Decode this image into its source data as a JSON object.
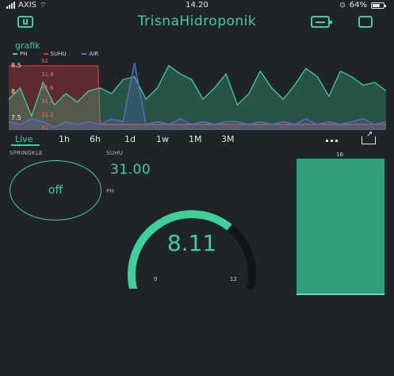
{
  "status_bar": {
    "carrier": "AXIS",
    "time": "14.20",
    "battery": "64%"
  },
  "header": {
    "title": "TrisnaHidroponik"
  },
  "chart": {
    "title": "grafik",
    "legend": [
      "PH",
      "SUHU",
      "AIR"
    ],
    "y_ticks_ph": [
      "8.5",
      "8",
      "7.5"
    ],
    "y_ticks_suhu": [
      "32",
      "31.8",
      "31.6",
      "31.4",
      "31.2",
      "31"
    ],
    "ranges": [
      "Live",
      "1h",
      "6h",
      "1d",
      "1w",
      "1M",
      "3M"
    ],
    "active_range": "Live"
  },
  "chart_data": {
    "type": "line",
    "x": [
      0,
      1,
      2,
      3,
      4,
      5,
      6,
      7,
      8,
      9,
      10,
      11,
      12,
      13,
      14,
      15,
      16,
      17,
      18,
      19,
      20,
      21,
      22,
      23,
      24,
      25,
      26,
      27,
      28,
      29,
      30,
      31,
      32,
      33
    ],
    "series": [
      {
        "name": "PH",
        "color": "#3fcf9c",
        "fill": true,
        "values": [
          7.9,
          8.1,
          7.6,
          8.2,
          7.8,
          8.0,
          7.85,
          8.05,
          8.1,
          8.0,
          8.25,
          8.3,
          7.9,
          8.1,
          8.5,
          8.35,
          8.25,
          7.9,
          8.1,
          8.35,
          7.8,
          8.0,
          8.4,
          8.1,
          7.9,
          8.15,
          8.45,
          8.3,
          7.95,
          8.4,
          8.3,
          8.15,
          8.2,
          8.05
        ]
      },
      {
        "name": "SUHU",
        "color": "#d23a3a",
        "fill": true,
        "values": [
          32.0,
          32.0,
          32.0,
          32.0,
          32.0,
          32.0,
          32.0,
          32.0,
          31.0,
          31.0,
          31.0,
          31.0,
          31.0,
          31.0,
          31.0,
          31.0,
          31.0,
          31.0,
          31.0,
          31.0,
          31.0,
          31.0,
          31.0,
          31.0,
          31.0,
          31.0,
          31.0,
          31.0,
          31.0,
          31.0,
          31.0,
          31.0,
          31.0,
          31.0
        ]
      },
      {
        "name": "AIR",
        "color": "#5b6fd6",
        "fill": true,
        "values": [
          7.5,
          7.45,
          7.55,
          7.5,
          7.4,
          7.5,
          7.45,
          7.5,
          7.45,
          7.55,
          7.5,
          8.55,
          7.45,
          7.5,
          7.45,
          7.55,
          7.45,
          7.5,
          7.45,
          7.5,
          7.5,
          7.45,
          7.5,
          7.45,
          7.5,
          7.45,
          7.55,
          7.45,
          7.5,
          7.45,
          7.5,
          7.55,
          7.45,
          7.5
        ]
      }
    ],
    "ylim_ph": [
      7.35,
      8.65
    ],
    "ylim_suhu": [
      30.9,
      32.15
    ]
  },
  "widgets": {
    "springkle": {
      "label": "SPRINGKLE",
      "state": "off"
    },
    "suhu": {
      "label": "SUHU",
      "value": "31.00"
    },
    "ph": {
      "label": "PH",
      "value": "8.11",
      "min": "0",
      "max": "12",
      "fraction": 0.676
    },
    "level": {
      "max": "16",
      "fraction": 1.0
    }
  }
}
